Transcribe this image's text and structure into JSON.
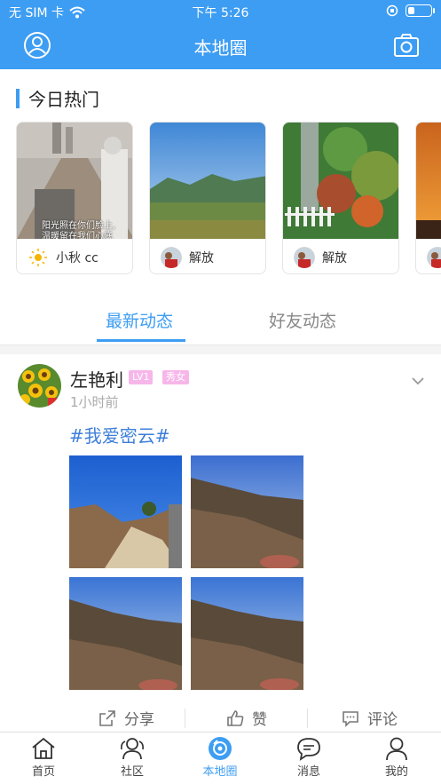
{
  "status_bar": {
    "carrier": "无 SIM 卡",
    "time": "下午 5:26",
    "battery_level": 0.3
  },
  "nav": {
    "title": "本地圈"
  },
  "hot": {
    "title": "今日热门",
    "cards": [
      {
        "user": "小秋 cc",
        "caption_line1": "阳光照在你们脸上,",
        "caption_line2": "温暖留在我们心底"
      },
      {
        "user": "解放"
      },
      {
        "user": "解放"
      },
      {
        "user": ""
      }
    ]
  },
  "tabs": {
    "latest": "最新动态",
    "friends": "好友动态"
  },
  "post": {
    "user": "左艳利",
    "level": "LV1",
    "gender": "秀女",
    "time": "1小时前",
    "hashtag": "#我爱密云#"
  },
  "actions": {
    "share": "分享",
    "like": "赞",
    "comment": "评论"
  },
  "tabbar": {
    "home": "首页",
    "community": "社区",
    "local": "本地圈",
    "messages": "消息",
    "mine": "我的"
  },
  "colors": {
    "accent": "#3d9df3",
    "badge": "#f7b6e9",
    "hashtag": "#3d7fd9"
  }
}
